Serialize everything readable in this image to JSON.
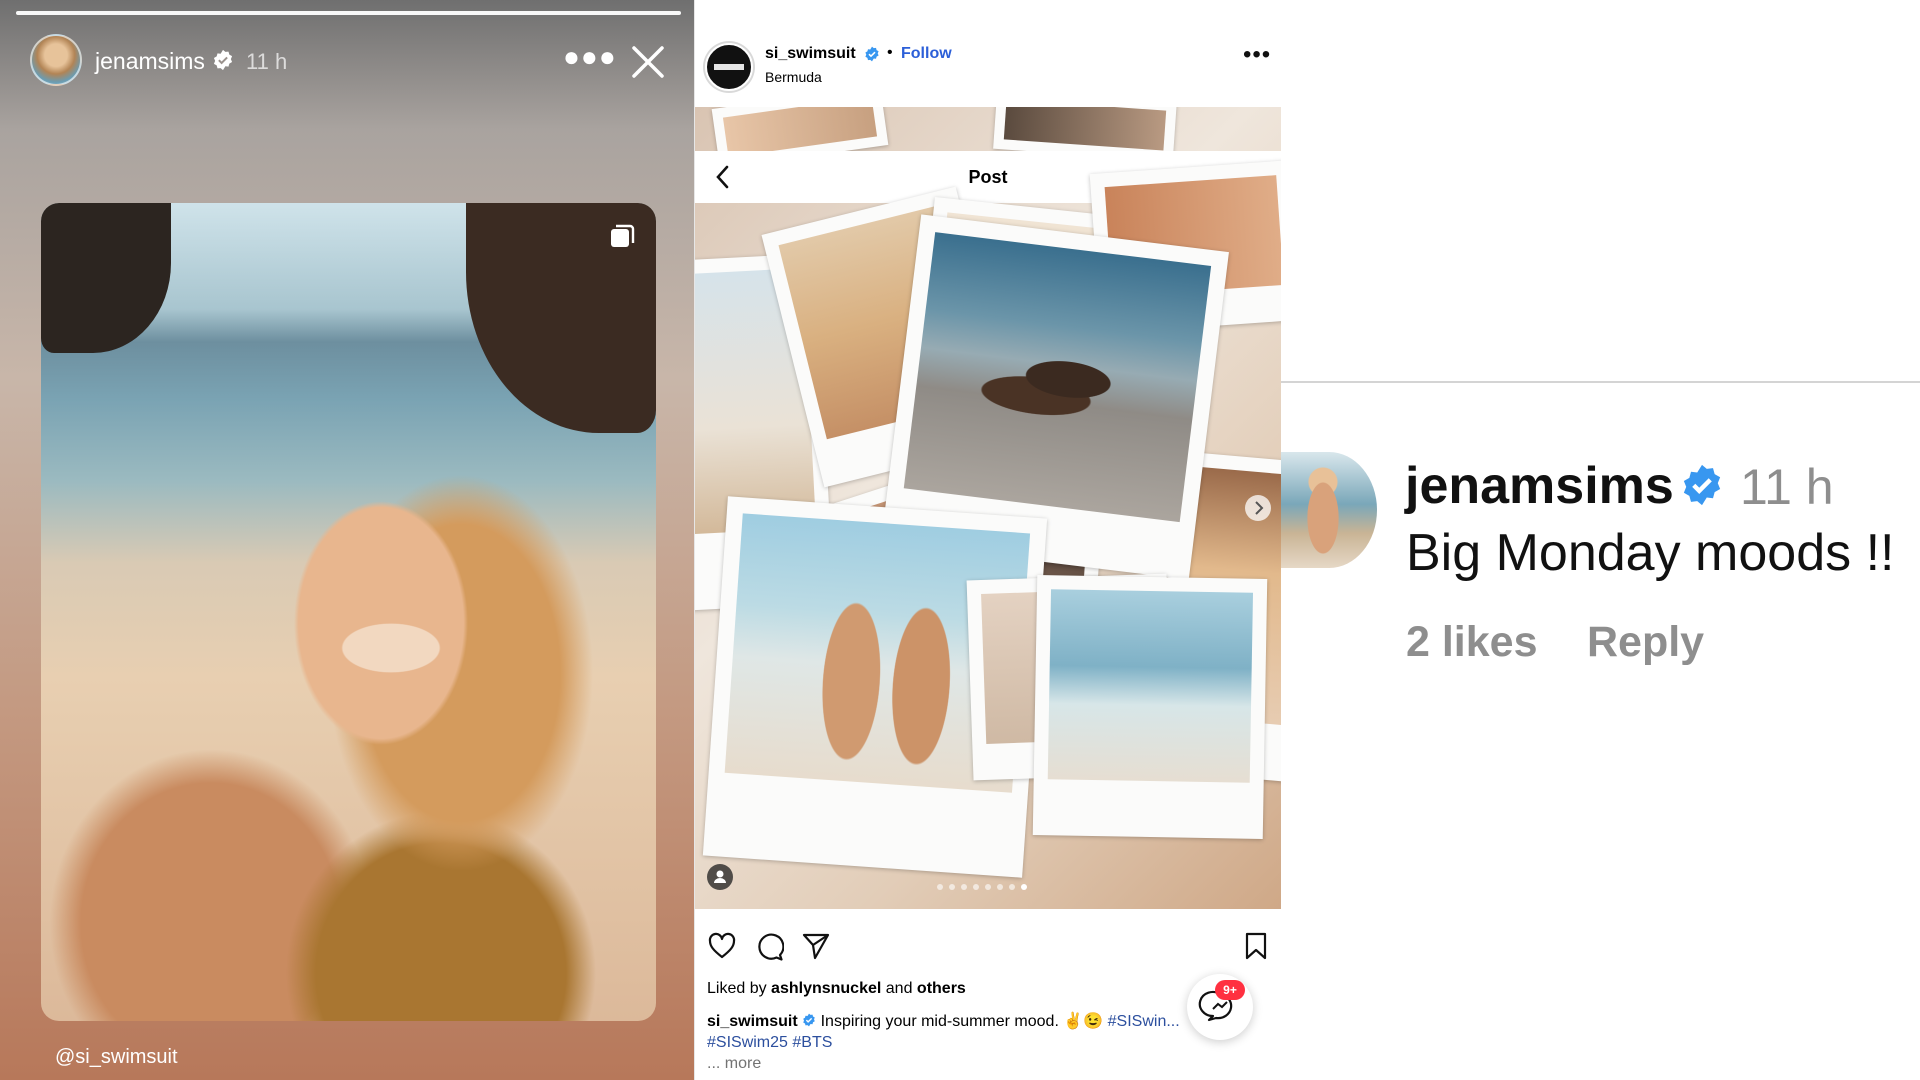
{
  "story": {
    "username": "jenamsims",
    "time": "11 h",
    "mention": "@si_swimsuit",
    "icons": {
      "verified": "verified-badge-icon",
      "more": "more-dots-icon",
      "close": "close-icon",
      "layers": "carousel-layers-icon"
    }
  },
  "post": {
    "username": "si_swimsuit",
    "separator": "•",
    "follow_label": "Follow",
    "location": "Bermuda",
    "more": "•••",
    "subheader_title": "Post",
    "liked_by_prefix": "Liked by ",
    "liked_by_user": "ashlynsnuckel",
    "liked_by_and": " and ",
    "liked_by_others": "others",
    "caption_user": "si_swimsuit",
    "caption_text": " Inspiring your mid-summer mood. ✌️😉 ",
    "caption_tag1": "#SISwin...",
    "caption_tag2": "#SISwim25",
    "caption_tag3": "#BTS",
    "more_label": "... more",
    "messenger_badge": "9+",
    "icons": {
      "like": "heart-icon",
      "comment": "comment-icon",
      "share": "send-icon",
      "save": "bookmark-icon",
      "messenger": "messenger-icon",
      "next": "chevron-right-icon",
      "back": "back-arrow-icon",
      "tag": "person-tag-icon"
    }
  },
  "comment": {
    "username": "jenamsims",
    "time": "11 h",
    "text": "Big Monday moods !!",
    "likes": "2 likes",
    "reply": "Reply"
  },
  "colors": {
    "link_blue": "#2c5fd8",
    "verified_blue": "#3897f0",
    "badge_red": "#ff3040",
    "muted_gray": "#8e8e8e"
  }
}
